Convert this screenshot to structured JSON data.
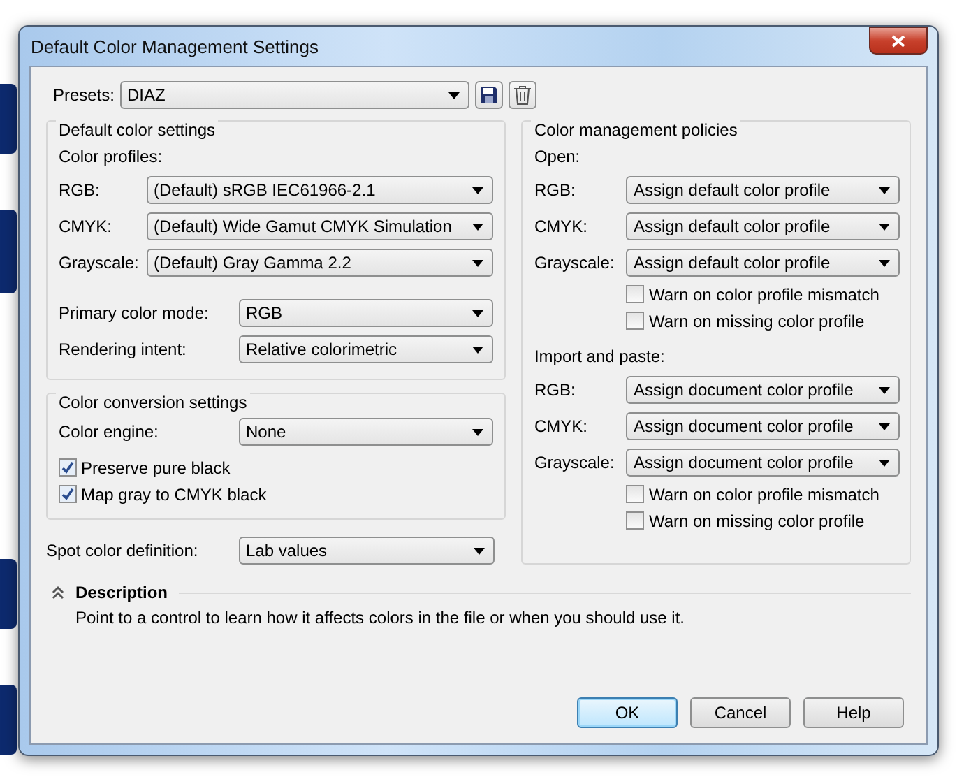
{
  "window": {
    "title": "Default Color Management Settings"
  },
  "presets": {
    "label": "Presets:",
    "value": "DIAZ"
  },
  "default_color_settings": {
    "title": "Default color settings",
    "profiles_label": "Color profiles:",
    "profiles": [
      {
        "label": "RGB:",
        "value": "(Default) sRGB IEC61966-2.1"
      },
      {
        "label": "CMYK:",
        "value": "(Default) Wide Gamut CMYK Simulation"
      },
      {
        "label": "Grayscale:",
        "value": "(Default) Gray Gamma 2.2"
      }
    ],
    "rows": [
      {
        "label": "Primary color mode:",
        "value": "RGB"
      },
      {
        "label": "Rendering intent:",
        "value": "Relative colorimetric"
      }
    ]
  },
  "conversion": {
    "title": "Color conversion settings",
    "engine": {
      "label": "Color engine:",
      "value": "None"
    },
    "options": [
      {
        "label": "Preserve pure black",
        "checked": true
      },
      {
        "label": "Map gray to CMYK black",
        "checked": true
      }
    ]
  },
  "spot": {
    "label": "Spot color definition:",
    "value": "Lab values"
  },
  "policies": {
    "title": "Color management policies",
    "sections": [
      {
        "heading": "Open:",
        "rows": [
          {
            "label": "RGB:",
            "value": "Assign default color profile"
          },
          {
            "label": "CMYK:",
            "value": "Assign default color profile"
          },
          {
            "label": "Grayscale:",
            "value": "Assign default color profile"
          }
        ],
        "options": [
          {
            "label": "Warn on color profile mismatch",
            "checked": false
          },
          {
            "label": "Warn on missing color profile",
            "checked": false
          }
        ]
      },
      {
        "heading": "Import and paste:",
        "rows": [
          {
            "label": "RGB:",
            "value": "Assign document color profile"
          },
          {
            "label": "CMYK:",
            "value": "Assign document color profile"
          },
          {
            "label": "Grayscale:",
            "value": "Assign document color profile"
          }
        ],
        "options": [
          {
            "label": "Warn on color profile mismatch",
            "checked": false
          },
          {
            "label": "Warn on missing color profile",
            "checked": false
          }
        ]
      }
    ]
  },
  "description": {
    "title": "Description",
    "expanded": true,
    "text": "Point to a control to learn how it affects colors in the file or when you should use it."
  },
  "buttons": [
    {
      "label": "OK",
      "default": true
    },
    {
      "label": "Cancel",
      "default": false
    },
    {
      "label": "Help",
      "default": false
    }
  ]
}
